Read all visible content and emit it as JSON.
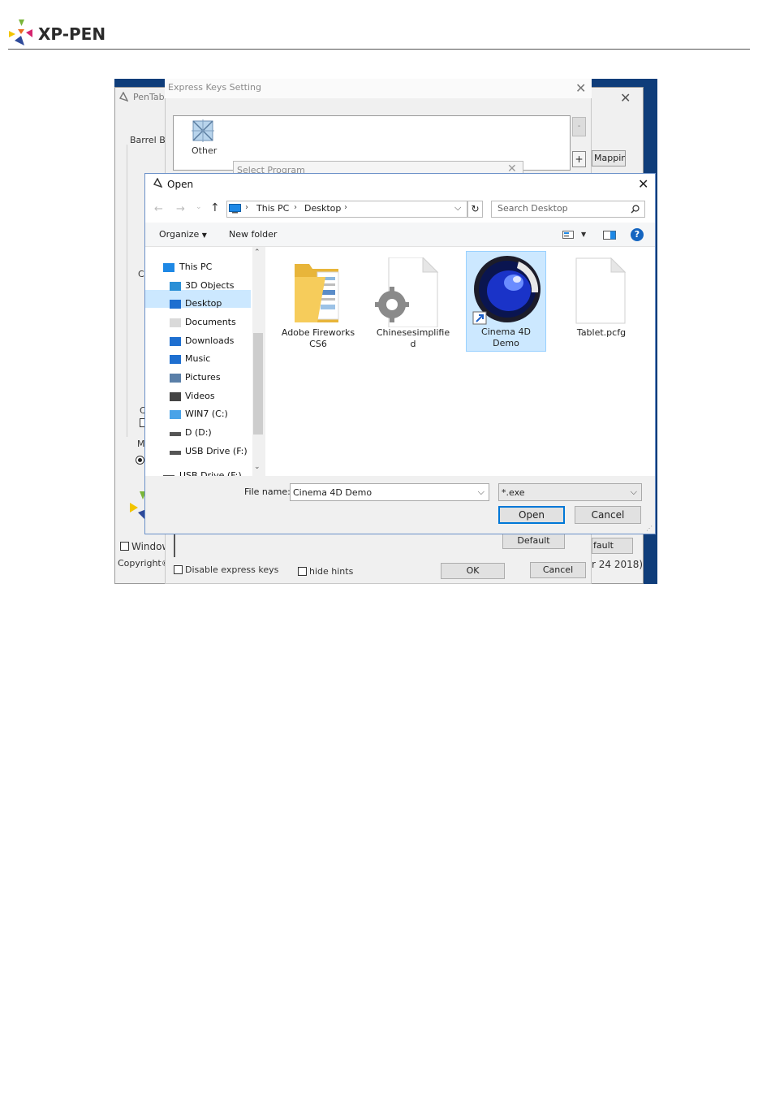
{
  "brand": {
    "logo_text": "XP-PEN"
  },
  "pentablet": {
    "title": "PenTabl",
    "barrel_label": "Barrel Bu",
    "side_c1": "Cl",
    "side_c2": "C",
    "side_m": "M",
    "windows_label": "Window",
    "copyright": "Copyright©",
    "mapping_label": "Mappin",
    "default_label": "fault",
    "date_text": "r 24 2018)"
  },
  "express_keys": {
    "title": "Express Keys Setting",
    "item_label": "Other",
    "plus_label": "+",
    "default_button": "Default",
    "disable_label": "Disable express keys",
    "hide_hints_label": "hide hints",
    "ok_button": "OK",
    "cancel_button": "Cancel"
  },
  "select_program": {
    "title": "Select Program"
  },
  "open_dialog": {
    "title": "Open",
    "breadcrumb": [
      "This PC",
      "Desktop"
    ],
    "search_placeholder": "Search Desktop",
    "organize_label": "Organize",
    "new_folder_label": "New folder",
    "nav_items": [
      {
        "label": "This PC",
        "icon": "pc-icon"
      },
      {
        "label": "3D Objects",
        "icon": "cube-icon"
      },
      {
        "label": "Desktop",
        "icon": "desktop-icon",
        "selected": true
      },
      {
        "label": "Documents",
        "icon": "document-icon"
      },
      {
        "label": "Downloads",
        "icon": "download-icon"
      },
      {
        "label": "Music",
        "icon": "music-icon"
      },
      {
        "label": "Pictures",
        "icon": "picture-icon"
      },
      {
        "label": "Videos",
        "icon": "video-icon"
      },
      {
        "label": "WIN7 (C:)",
        "icon": "windows-drive-icon"
      },
      {
        "label": "D (D:)",
        "icon": "drive-icon"
      },
      {
        "label": "USB Drive (F:)",
        "icon": "usb-drive-icon"
      },
      {
        "label": "USB Drive (F:)",
        "icon": "usb-drive-icon"
      }
    ],
    "files": [
      {
        "line1": "Adobe Fireworks",
        "line2": "CS6",
        "icon": "folder-icon"
      },
      {
        "line1": "Chinesesimplifie",
        "line2": "d",
        "icon": "settings-file-icon"
      },
      {
        "line1": "Cinema 4D",
        "line2": "Demo",
        "icon": "cinema4d-icon",
        "selected": true
      },
      {
        "line1": "Tablet.pcfg",
        "line2": "",
        "icon": "blank-file-icon"
      }
    ],
    "file_name_label": "File name:",
    "file_name_value": "Cinema 4D Demo",
    "filter_value": "*.exe",
    "open_button": "Open",
    "cancel_button": "Cancel"
  },
  "colors": {
    "accent": "#0078d7",
    "selection": "#cce8ff",
    "selection_border": "#99d1ff"
  }
}
